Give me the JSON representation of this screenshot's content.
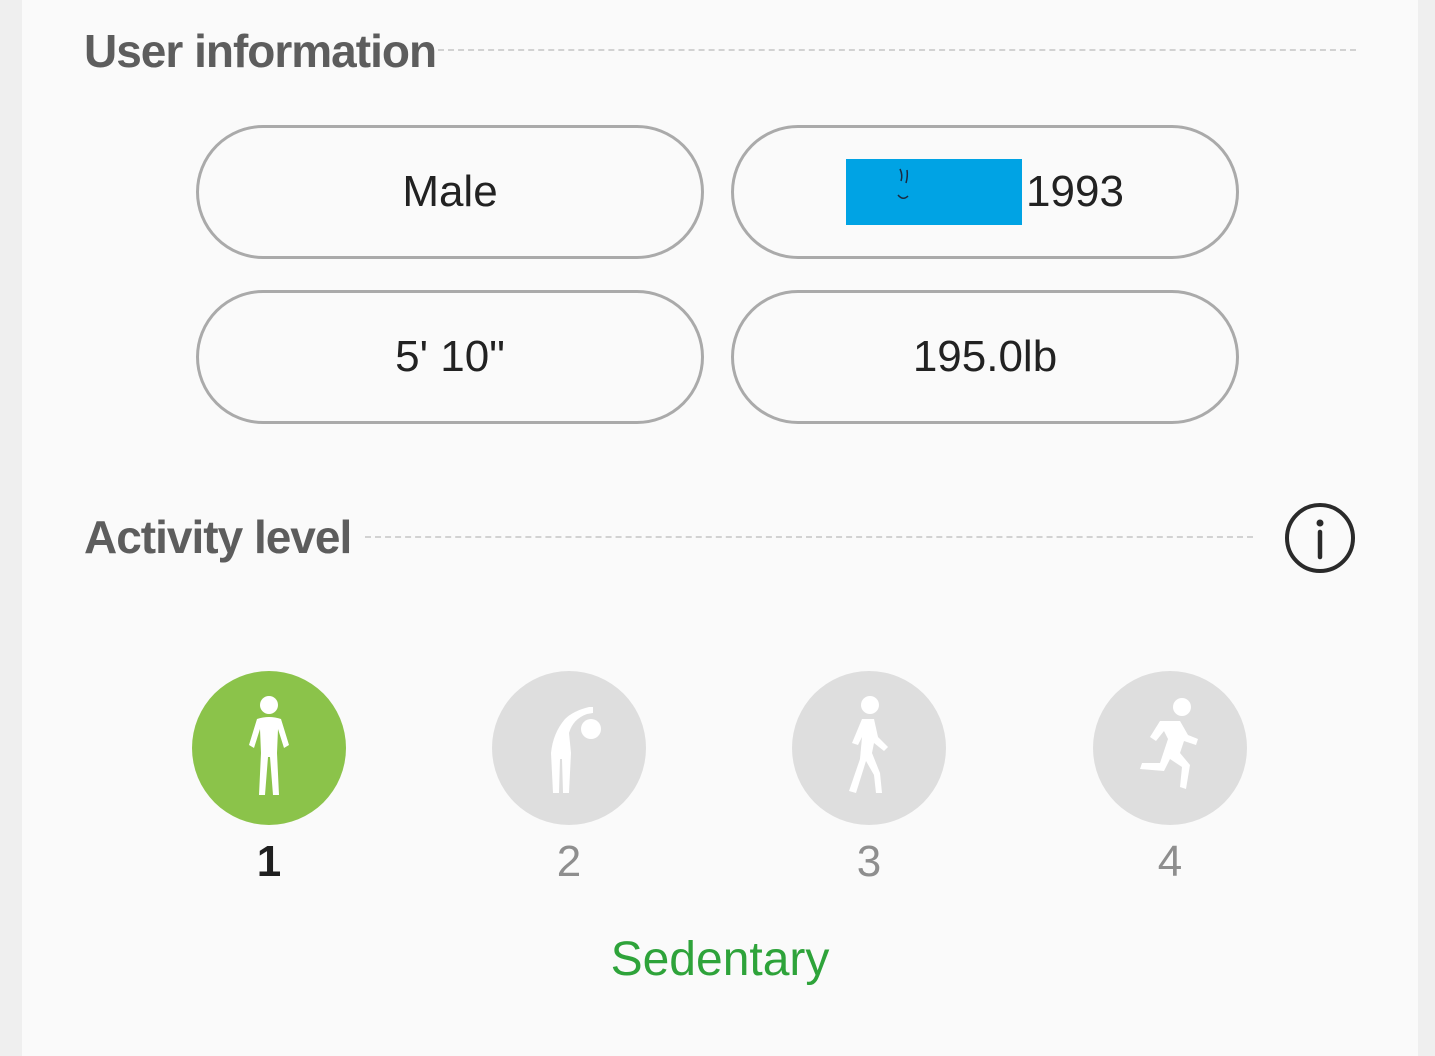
{
  "user_information": {
    "title": "User information",
    "gender": "Male",
    "birth_year": "1993",
    "height": "5' 10\"",
    "weight": "195.0lb"
  },
  "activity_level": {
    "title": "Activity level",
    "info_icon": "info-circle-icon",
    "levels": [
      {
        "number": "1",
        "icon": "standing-person-icon",
        "selected": true
      },
      {
        "number": "2",
        "icon": "stretching-person-icon",
        "selected": false
      },
      {
        "number": "3",
        "icon": "walking-person-icon",
        "selected": false
      },
      {
        "number": "4",
        "icon": "running-person-icon",
        "selected": false
      }
    ],
    "selected_description": "Sedentary"
  },
  "colors": {
    "selected_green": "#8bc34a",
    "description_green": "#2ea33a",
    "inactive_circle": "#dedede",
    "redaction_blue": "#00a3e4"
  }
}
